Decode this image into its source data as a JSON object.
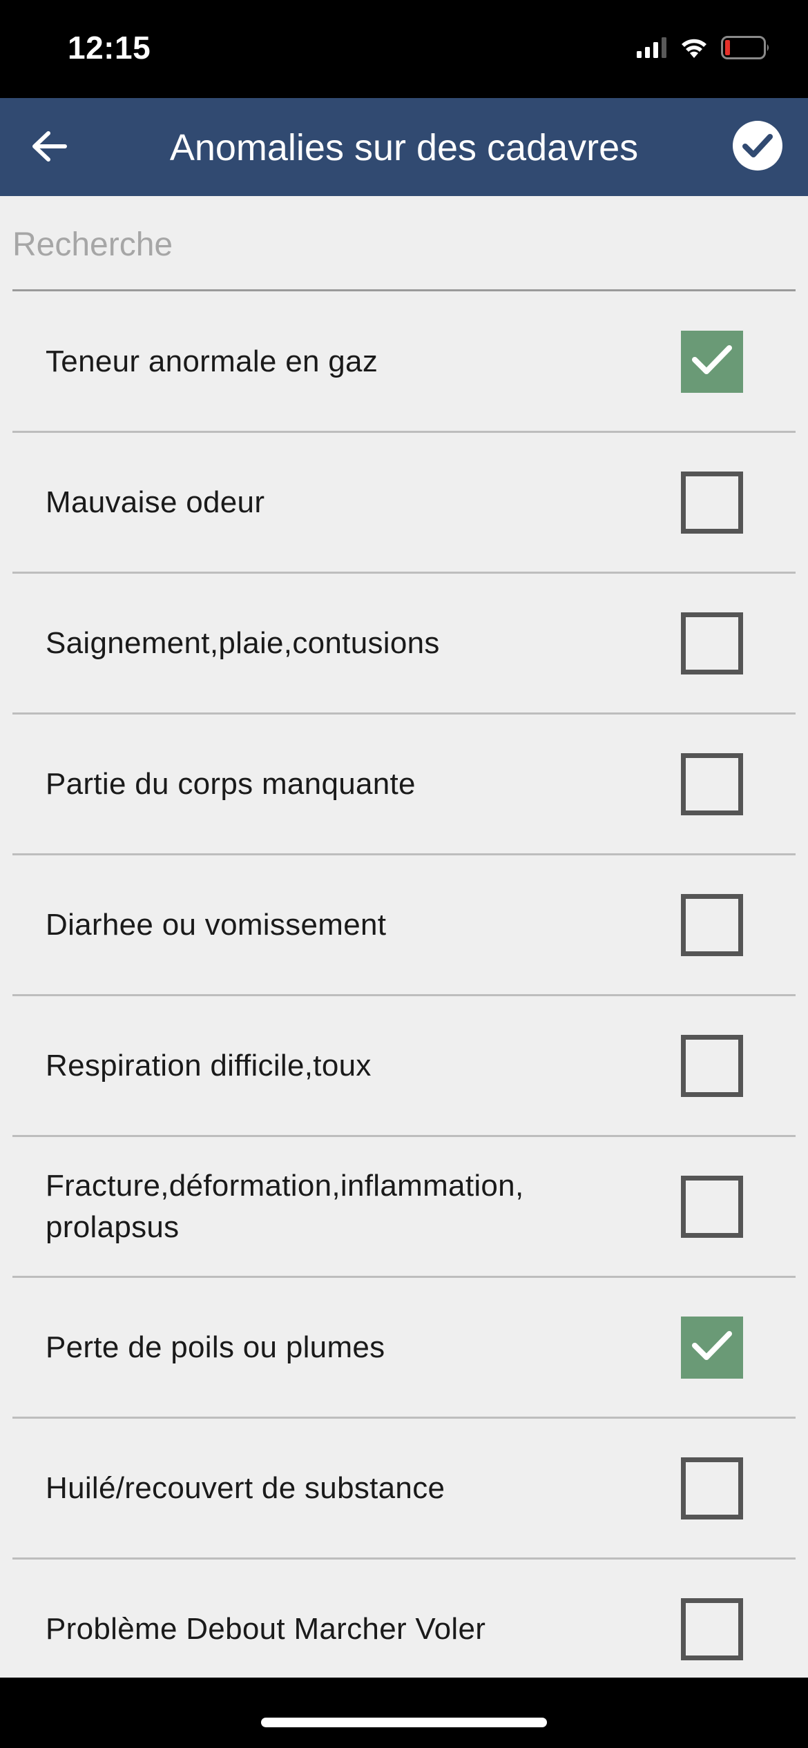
{
  "status_bar": {
    "time": "12:15"
  },
  "header": {
    "title": "Anomalies sur des cadavres",
    "back_icon": "arrow-left-icon",
    "confirm_icon": "check-circle-icon"
  },
  "search": {
    "placeholder": "Recherche",
    "value": ""
  },
  "items": [
    {
      "label": "Teneur anormale en gaz",
      "checked": true
    },
    {
      "label": "Mauvaise odeur",
      "checked": false
    },
    {
      "label": "Saignement,plaie,contusions",
      "checked": false
    },
    {
      "label": "Partie du corps manquante",
      "checked": false
    },
    {
      "label": "Diarhee ou vomissement",
      "checked": false
    },
    {
      "label": "Respiration difficile,toux",
      "checked": false
    },
    {
      "label": "Fracture,déformation,inflammation, prolapsus",
      "checked": false
    },
    {
      "label": "Perte de poils ou plumes",
      "checked": true
    },
    {
      "label": "Huilé/recouvert de substance",
      "checked": false
    },
    {
      "label": "Problème Debout Marcher Voler",
      "checked": false
    }
  ],
  "colors": {
    "header_bg": "#314a71",
    "checked_bg": "#6a9a76",
    "unchecked_border": "#555555",
    "page_bg": "#efefef"
  }
}
